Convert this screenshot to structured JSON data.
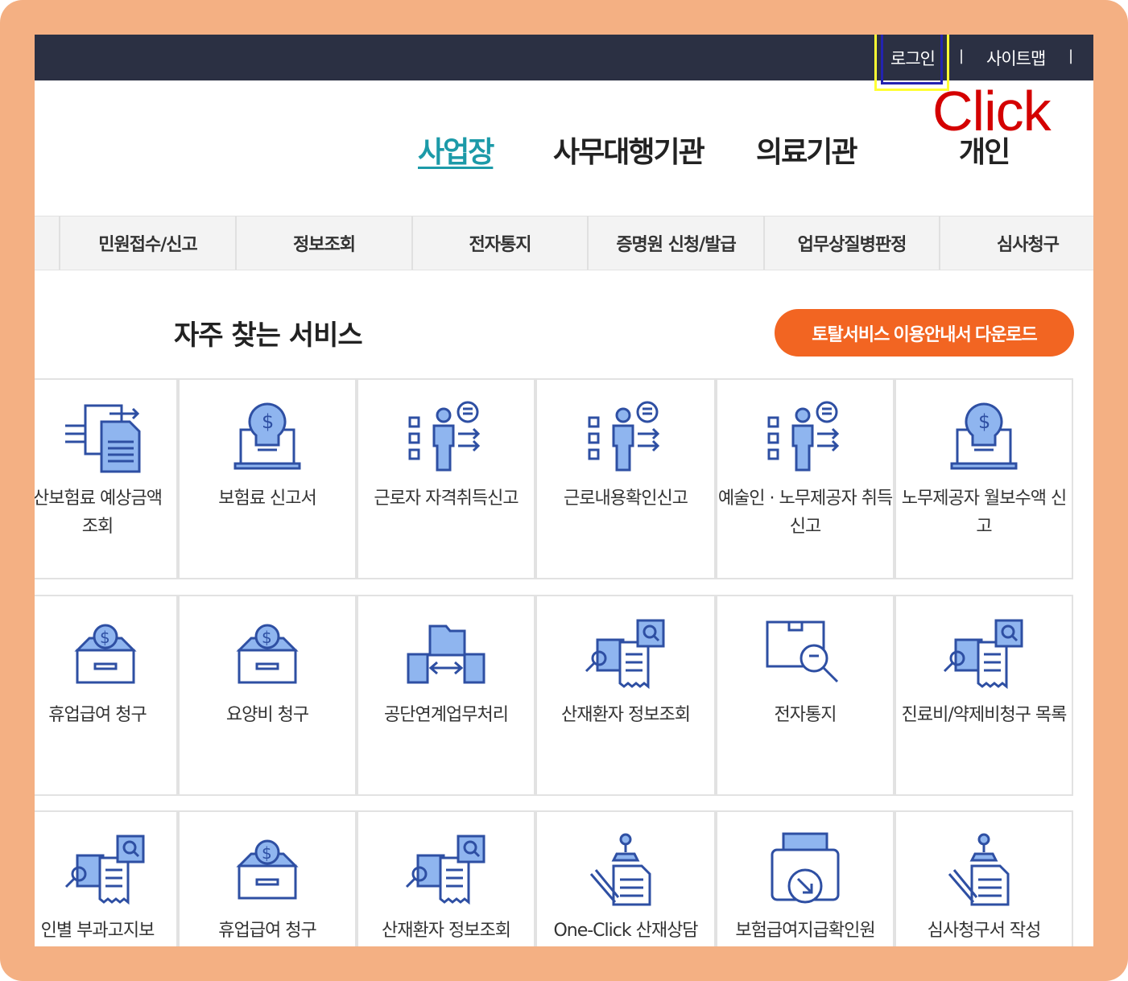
{
  "top_links": {
    "login": "로그인",
    "separator": "|",
    "sitemap": "사이트맵"
  },
  "annotation": {
    "click": "Click"
  },
  "audience_tabs": [
    "사업장",
    "사무대행기관",
    "의료기관",
    "개인"
  ],
  "menu": [
    "민원접수/신고",
    "정보조회",
    "전자통지",
    "증명원 신청/발급",
    "업무상질병판정",
    "심사청구"
  ],
  "section": {
    "title": "자주 찾는 서비스",
    "download": "토탈서비스 이용안내서 다운로드"
  },
  "colors": {
    "topbar": "#2b3043",
    "accent": "#1c9aa8",
    "orange": "#f26522",
    "icon_blue": "#2e4fa3",
    "icon_light": "#8fb5ef"
  },
  "services": [
    [
      {
        "label": "산보험료 예상금액 조회",
        "icon": "document-transfer-icon"
      },
      {
        "label": "보험료 신고서",
        "icon": "laptop-money-icon"
      },
      {
        "label": "근로자 자격취득신고",
        "icon": "presenter-checklist-icon"
      },
      {
        "label": "근로내용확인신고",
        "icon": "presenter-checklist-icon"
      },
      {
        "label": "예술인 · 노무제공자 취득신고",
        "icon": "presenter-checklist-icon"
      },
      {
        "label": "노무제공자 월보수액 신고",
        "icon": "laptop-money-icon"
      }
    ],
    [
      {
        "label": "휴업급여 청구",
        "icon": "money-box-icon"
      },
      {
        "label": "요양비 청구",
        "icon": "money-box-icon"
      },
      {
        "label": "공단연계업무처리",
        "icon": "folder-exchange-icon"
      },
      {
        "label": "산재환자 정보조회",
        "icon": "document-search-icon"
      },
      {
        "label": "전자통지",
        "icon": "box-search-icon"
      },
      {
        "label": "진료비/약제비청구 목록",
        "icon": "document-search-icon"
      }
    ],
    [
      {
        "label": "인별 부과고지보",
        "icon": "document-search-icon"
      },
      {
        "label": "휴업급여 청구",
        "icon": "money-box-icon"
      },
      {
        "label": "산재환자 정보조회",
        "icon": "document-search-icon"
      },
      {
        "label": "One-Click 산재상담",
        "icon": "stamp-document-icon"
      },
      {
        "label": "보험급여지급확인원",
        "icon": "printer-icon"
      },
      {
        "label": "심사청구서 작성",
        "icon": "stamp-document-icon"
      }
    ]
  ]
}
